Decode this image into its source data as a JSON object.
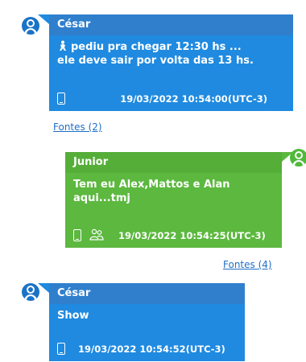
{
  "messages": [
    {
      "sender": "César",
      "text": "pediu pra chegar 12:30 hs ... ele deve sair por volta das 13 hs.",
      "text_line1": "pediu pra chegar 12:30 hs ...",
      "text_line2": "ele deve sair por volta das 13 hs.",
      "timestamp": "19/03/2022 10:54:00(UTC-3)",
      "sources_link": "Fontes (2)"
    },
    {
      "sender": "Junior",
      "text_line1": "Tem eu Alex,Mattos e Alan",
      "text_line2": "aqui...tmj",
      "timestamp": "19/03/2022 10:54:25(UTC-3)",
      "sources_link": "Fontes (4)"
    },
    {
      "sender": "César",
      "text_line1": "Show",
      "timestamp": "19/03/2022 10:54:52(UTC-3)"
    }
  ],
  "colors": {
    "incoming_bubble": "#1f8ae0",
    "incoming_header": "#2f7fcd",
    "outgoing_bubble": "#5cb83f",
    "outgoing_header": "#55ae38",
    "link": "#1f6fc5"
  }
}
